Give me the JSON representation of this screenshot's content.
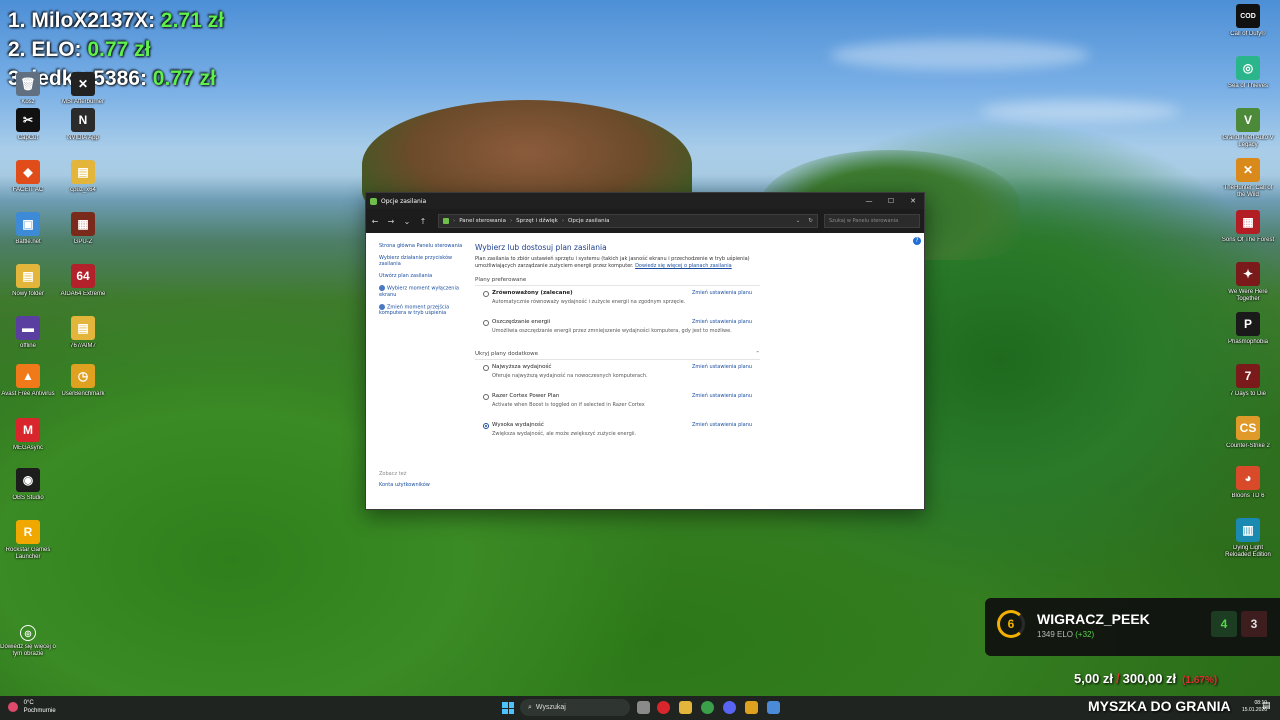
{
  "leaderboard": [
    {
      "rank": "1.",
      "name": "MiloX2137X:",
      "amount": "2.71 zł"
    },
    {
      "rank": "2.",
      "name": "ELO:",
      "amount": "0.77 zł"
    },
    {
      "rank": "3.",
      "name": "jedker5386:",
      "amount": "0.77 zł"
    }
  ],
  "desktop_left": [
    {
      "label": "Kosz",
      "color": "#607080",
      "glyph": "🗑"
    },
    {
      "label": "MSI Afterburner",
      "color": "#222222",
      "glyph": "✕"
    },
    {
      "label": "The Finals",
      "color": "#c83a3a",
      "glyph": "▦"
    },
    {
      "label": "CapCut",
      "color": "#111111",
      "glyph": "✂"
    },
    {
      "label": "NVIDIA App",
      "color": "#2b2b2b",
      "glyph": "N"
    },
    {
      "label": "FACEIT AC",
      "color": "#e04c1a",
      "glyph": "◆"
    },
    {
      "label": "cpuz_x64",
      "color": "#e3b63b",
      "glyph": "▤"
    },
    {
      "label": "Battle.net",
      "color": "#3d8bd6",
      "glyph": "▣"
    },
    {
      "label": "GPU-Z",
      "color": "#7a2a1a",
      "glyph": "▦"
    },
    {
      "label": "Nowy folder",
      "color": "#e3b63b",
      "glyph": "▤"
    },
    {
      "label": "AIDA64 Extreme",
      "color": "#b3222b",
      "glyph": "64"
    },
    {
      "label": "offline",
      "color": "#5a3fa0",
      "glyph": "▬"
    },
    {
      "label": "767/AIM7",
      "color": "#e3b63b",
      "glyph": "▤"
    },
    {
      "label": "Avast Free Antivirus",
      "color": "#f07a1a",
      "glyph": "▲"
    },
    {
      "label": "UserBenchmark",
      "color": "#e0a020",
      "glyph": "◷"
    },
    {
      "label": "MEGAsync",
      "color": "#d9262c",
      "glyph": "M"
    },
    {
      "label": "OBS Studio",
      "color": "#1d1d1d",
      "glyph": "◉"
    },
    {
      "label": "Rockstar Games Launcher",
      "color": "#f0a800",
      "glyph": "R"
    }
  ],
  "desktop_right": [
    {
      "label": "Call of Duty®",
      "color": "#111111",
      "glyph": "COD"
    },
    {
      "label": "Sea of Thieves",
      "color": "#2bb58a",
      "glyph": "◎"
    },
    {
      "label": "Grand Theft Auto V Legacy",
      "color": "#4c8a3a",
      "glyph": "V"
    },
    {
      "label": "TheHunter: Call of the Wild",
      "color": "#d98a1a",
      "glyph": "✕"
    },
    {
      "label": "Sons Of The Forest",
      "color": "#b31d24",
      "glyph": "▦"
    },
    {
      "label": "We Were Here Together",
      "color": "#7a1a1a",
      "glyph": "✦"
    },
    {
      "label": "Phasmophobia",
      "color": "#1a1a1a",
      "glyph": "P"
    },
    {
      "label": "7 Days to Die",
      "color": "#7a1a1a",
      "glyph": "7"
    },
    {
      "label": "Counter-Strike 2",
      "color": "#e09a2a",
      "glyph": "CS"
    },
    {
      "label": "Bloons TD 6",
      "color": "#d94a2a",
      "glyph": "◕"
    },
    {
      "label": "Dying Light Reloaded Edition",
      "color": "#1a8ab3",
      "glyph": "▥"
    }
  ],
  "window": {
    "title": "Opcje zasilania",
    "controls": {
      "minimize": "—",
      "maximize": "☐",
      "close": "✕"
    },
    "nav": {
      "back": "←",
      "forward": "→",
      "down": "⌄",
      "up": "↑"
    },
    "breadcrumb": [
      "Panel sterowania",
      "Sprzęt i dźwięk",
      "Opcje zasilania"
    ],
    "search_placeholder": "Szukaj w Panelu sterowania",
    "left_nav": [
      "Strona główna Panelu sterowania",
      "Wybierz działanie przycisków zasilania",
      "Utwórz plan zasilania",
      "Wybierz moment wyłączenia ekranu",
      "Zmień moment przejścia komputera w tryb uśpienia"
    ],
    "see_also": {
      "title": "Zobacz też",
      "items": [
        "Konta użytkowników"
      ]
    },
    "heading": "Wybierz lub dostosuj plan zasilania",
    "description": "Plan zasilania to zbiór ustawień sprzętu i systemu (takich jak jasność ekranu i przechodzenie w tryb uśpienia) umożliwiających zarządzanie zużyciem energii przez komputer.",
    "description_link": "Dowiedz się więcej o planach zasilania",
    "preferred_section": "Plany preferowane",
    "hidden_section": "Ukryj plany dodatkowe",
    "change_settings_label": "Zmień ustawienia planu",
    "preferred_plans": [
      {
        "name": "Zrównoważony (zalecane)",
        "desc": "Automatycznie równoważy wydajność i zużycie energii na zgodnym sprzęcie.",
        "selected": false
      },
      {
        "name": "Oszczędzanie energii",
        "desc": "Umożliwia oszczędzanie energii przez zmniejszenie wydajności komputera, gdy jest to możliwe.",
        "selected": false
      }
    ],
    "additional_plans": [
      {
        "name": "Najwyższa wydajność",
        "desc": "Oferuje najwyższą wydajność na nowoczesnych komputerach.",
        "selected": false
      },
      {
        "name": "Razer Cortex Power Plan",
        "desc": "Activate when Boost is toggled on if selected in Razer Cortex",
        "selected": false
      },
      {
        "name": "Wysoka wydajność",
        "desc": "Zwiększa wydajność, ale może zwiększyć zużycie energii.",
        "selected": true
      }
    ]
  },
  "widget": {
    "level": "6",
    "name": "WIGRACZ_PEEK",
    "elo": "1349 ELO",
    "elo_gain": "(+32)",
    "wins": "4",
    "losses": "3"
  },
  "goal": {
    "current": "5,00 zł",
    "target": "300,00 zł",
    "extra": "(1.67%)"
  },
  "brand": "MYSZKA DO GRANIA",
  "taskbar": {
    "weather_temp": "0°C",
    "weather_desc": "Pochmurnie",
    "search_label": "Wyszukaj",
    "time": "08:10",
    "date": "15.01.2026"
  },
  "bottom_left_icon_label": "Dowiedz się więcej o tym obrazie"
}
